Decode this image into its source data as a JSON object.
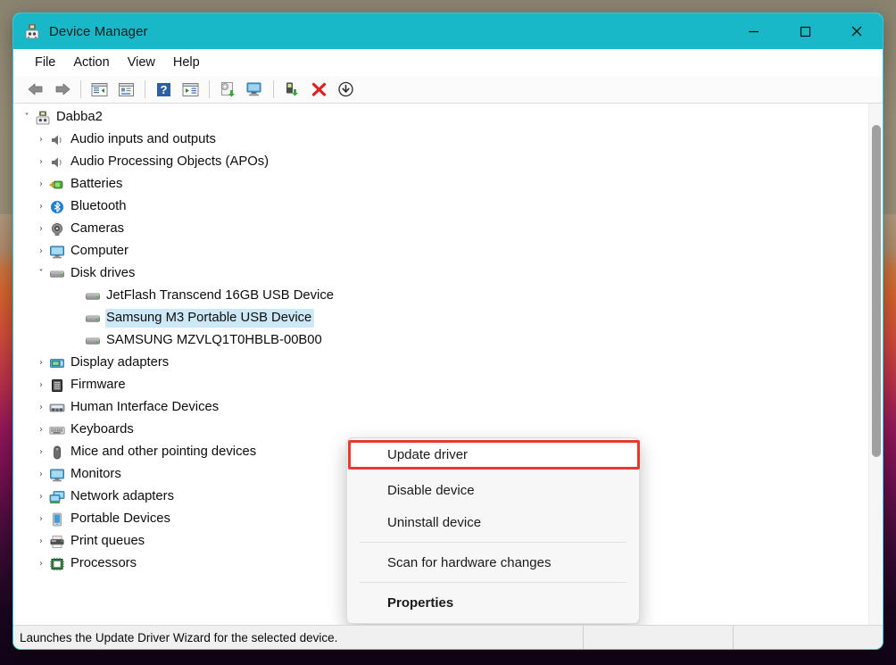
{
  "window": {
    "title": "Device Manager",
    "title_icon": "device-manager-icon",
    "accent_color": "#18b8c8",
    "controls": {
      "minimize": "—",
      "maximize": "□",
      "close": "✕"
    }
  },
  "menubar": {
    "items": [
      {
        "label": "File"
      },
      {
        "label": "Action"
      },
      {
        "label": "View"
      },
      {
        "label": "Help"
      }
    ]
  },
  "toolbar": {
    "buttons": [
      {
        "name": "back-arrow-icon"
      },
      {
        "name": "forward-arrow-icon"
      },
      {
        "name": "show-hide-console-tree-icon"
      },
      {
        "name": "properties-icon"
      },
      {
        "name": "help-icon"
      },
      {
        "name": "show-hide-action-pane-icon"
      },
      {
        "name": "update-driver-icon"
      },
      {
        "name": "scan-for-hardware-changes-icon"
      },
      {
        "name": "enable-device-icon"
      },
      {
        "name": "uninstall-device-icon"
      },
      {
        "name": "disable-device-icon"
      }
    ]
  },
  "tree": {
    "root": {
      "label": "Dabba2",
      "icon": "computer-node-icon",
      "expanded": true,
      "chevron": "˅"
    },
    "items": [
      {
        "label": "Audio inputs and outputs",
        "icon": "speaker-icon",
        "chevron": "›",
        "level": 1,
        "selected": false
      },
      {
        "label": "Audio Processing Objects (APOs)",
        "icon": "speaker-icon",
        "chevron": "›",
        "level": 1,
        "selected": false
      },
      {
        "label": "Batteries",
        "icon": "battery-icon",
        "chevron": "›",
        "level": 1,
        "selected": false
      },
      {
        "label": "Bluetooth",
        "icon": "bluetooth-icon",
        "chevron": "›",
        "level": 1,
        "selected": false
      },
      {
        "label": "Cameras",
        "icon": "camera-icon",
        "chevron": "›",
        "level": 1,
        "selected": false
      },
      {
        "label": "Computer",
        "icon": "monitor-icon",
        "chevron": "›",
        "level": 1,
        "selected": false
      },
      {
        "label": "Disk drives",
        "icon": "disk-drive-icon",
        "chevron": "˅",
        "level": 1,
        "selected": false,
        "expanded": true
      },
      {
        "label": "JetFlash Transcend 16GB USB Device",
        "icon": "disk-drive-icon",
        "chevron": "",
        "level": 2,
        "selected": false
      },
      {
        "label": "Samsung M3 Portable USB Device",
        "icon": "disk-drive-icon",
        "chevron": "",
        "level": 2,
        "selected": true
      },
      {
        "label": "SAMSUNG MZVLQ1T0HBLB-00B00",
        "icon": "disk-drive-icon",
        "chevron": "",
        "level": 2,
        "selected": false
      },
      {
        "label": "Display adapters",
        "icon": "display-adapter-icon",
        "chevron": "›",
        "level": 1,
        "selected": false
      },
      {
        "label": "Firmware",
        "icon": "firmware-icon",
        "chevron": "›",
        "level": 1,
        "selected": false
      },
      {
        "label": "Human Interface Devices",
        "icon": "hid-icon",
        "chevron": "›",
        "level": 1,
        "selected": false
      },
      {
        "label": "Keyboards",
        "icon": "keyboard-icon",
        "chevron": "›",
        "level": 1,
        "selected": false
      },
      {
        "label": "Mice and other pointing devices",
        "icon": "mouse-icon",
        "chevron": "›",
        "level": 1,
        "selected": false
      },
      {
        "label": "Monitors",
        "icon": "monitor-icon",
        "chevron": "›",
        "level": 1,
        "selected": false
      },
      {
        "label": "Network adapters",
        "icon": "network-adapter-icon",
        "chevron": "›",
        "level": 1,
        "selected": false
      },
      {
        "label": "Portable Devices",
        "icon": "portable-device-icon",
        "chevron": "›",
        "level": 1,
        "selected": false
      },
      {
        "label": "Print queues",
        "icon": "printer-icon",
        "chevron": "›",
        "level": 1,
        "selected": false
      },
      {
        "label": "Processors",
        "icon": "processor-icon",
        "chevron": "›",
        "level": 1,
        "selected": false
      }
    ],
    "selection_color": "#cde8f7"
  },
  "context_menu": {
    "items": [
      {
        "label": "Update driver",
        "highlighted": true,
        "bold": false
      },
      {
        "label": "Disable device",
        "highlighted": false,
        "bold": false
      },
      {
        "label": "Uninstall device",
        "highlighted": false,
        "bold": false
      },
      {
        "separator_after": true
      },
      {
        "label": "Scan for hardware changes",
        "highlighted": false,
        "bold": false
      },
      {
        "separator_after": true
      },
      {
        "label": "Properties",
        "highlighted": false,
        "bold": true
      }
    ],
    "highlight_color": "#e8392f"
  },
  "statusbar": {
    "message": "Launches the Update Driver Wizard for the selected device."
  }
}
